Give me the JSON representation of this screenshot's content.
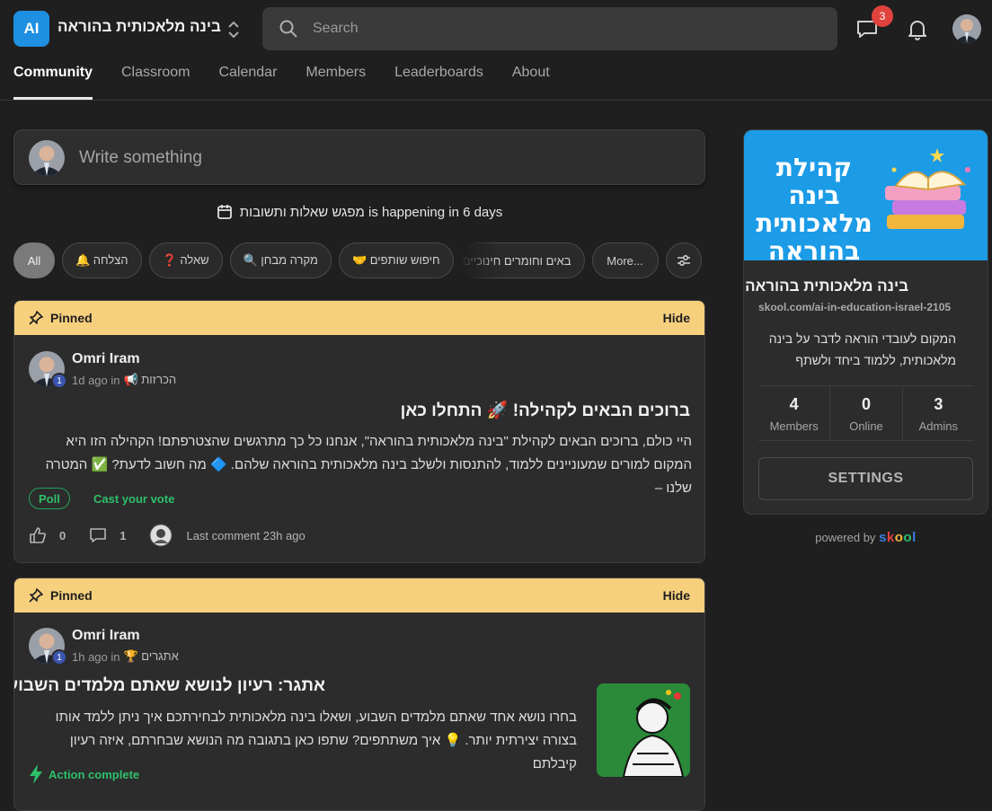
{
  "header": {
    "logo_text": "AI",
    "community_name": "בינה מלאכותית בהוראה",
    "search_placeholder": "Search",
    "chat_badge": "3"
  },
  "tabs": [
    {
      "label": "Community",
      "active": true
    },
    {
      "label": "Classroom"
    },
    {
      "label": "Calendar"
    },
    {
      "label": "Members"
    },
    {
      "label": "Leaderboards"
    },
    {
      "label": "About"
    }
  ],
  "composer": {
    "placeholder": "Write something"
  },
  "event": {
    "text": "מפגש שאלות ותשובות is happening in 6 days"
  },
  "filters": {
    "all": "All",
    "items": [
      "הצלחה 🔔",
      "שאלה ❓",
      "מקרה מבחן 🔍",
      "חיפוש שותפים 🤝",
      "באים וחומרים חינוכיים"
    ],
    "more": "More..."
  },
  "posts": [
    {
      "pinned_label": "Pinned",
      "hide_label": "Hide",
      "author": "Omri Iram",
      "level": "1",
      "time": "1d ago in",
      "category": "הכרזות 📢",
      "title": "ברוכים הבאים לקהילה! 🚀 התחלו כאן",
      "body": "היי כולם, ברוכים הבאים לקהילת \"בינה מלאכותית בהוראה\", אנחנו כל כך מתרגשים שהצטרפתם! הקהילה הזו היא המקום למורים שמעוניינים ללמוד, להתנסות ולשלב בינה מלאכותית בהוראה שלהם. 🔷 מה חשוב לדעת? ✅ המטרה שלנו –",
      "poll_label": "Poll",
      "vote_label": "Cast your vote",
      "likes": "0",
      "comments": "1",
      "last_comment": "Last comment 23h ago"
    },
    {
      "pinned_label": "Pinned",
      "hide_label": "Hide",
      "author": "Omri Iram",
      "level": "1",
      "time": "1h ago in",
      "category": "אתגרים 🏆",
      "title": "אתגר: רעיון לנושא שאתם מלמדים השבוע",
      "body": "בחרו נושא אחד שאתם מלמדים השבוע, ושאלו בינה מלאכותית לבחירתכם איך ניתן ללמד אותו בצורה יצירתית יותר. 💡 איך משתתפים? שתפו כאן בתגובה מה הנושא שבחרתם, איזה רעיון קיבלתם",
      "action_label": "Action complete"
    }
  ],
  "about_card": {
    "banner_title": "קהילת בינה מלאכותית בהוראה",
    "name": "בינה מלאכותית בהוראה",
    "url": "skool.com/ai-in-education-israel-2105",
    "description": "המקום לעובדי הוראה לדבר על בינה מלאכותית, ללמוד ביחד ולשתף",
    "stats": [
      {
        "value": "4",
        "label": "Members"
      },
      {
        "value": "0",
        "label": "Online"
      },
      {
        "value": "3",
        "label": "Admins"
      }
    ],
    "settings_label": "SETTINGS"
  },
  "footer": {
    "powered_by": "powered by",
    "brand": "skool"
  },
  "colors": {
    "accent_blue": "#1e8fe1",
    "pinned_bar": "#f7d07e",
    "success_green": "#2fbf6b",
    "badge_red": "#e0433d"
  }
}
